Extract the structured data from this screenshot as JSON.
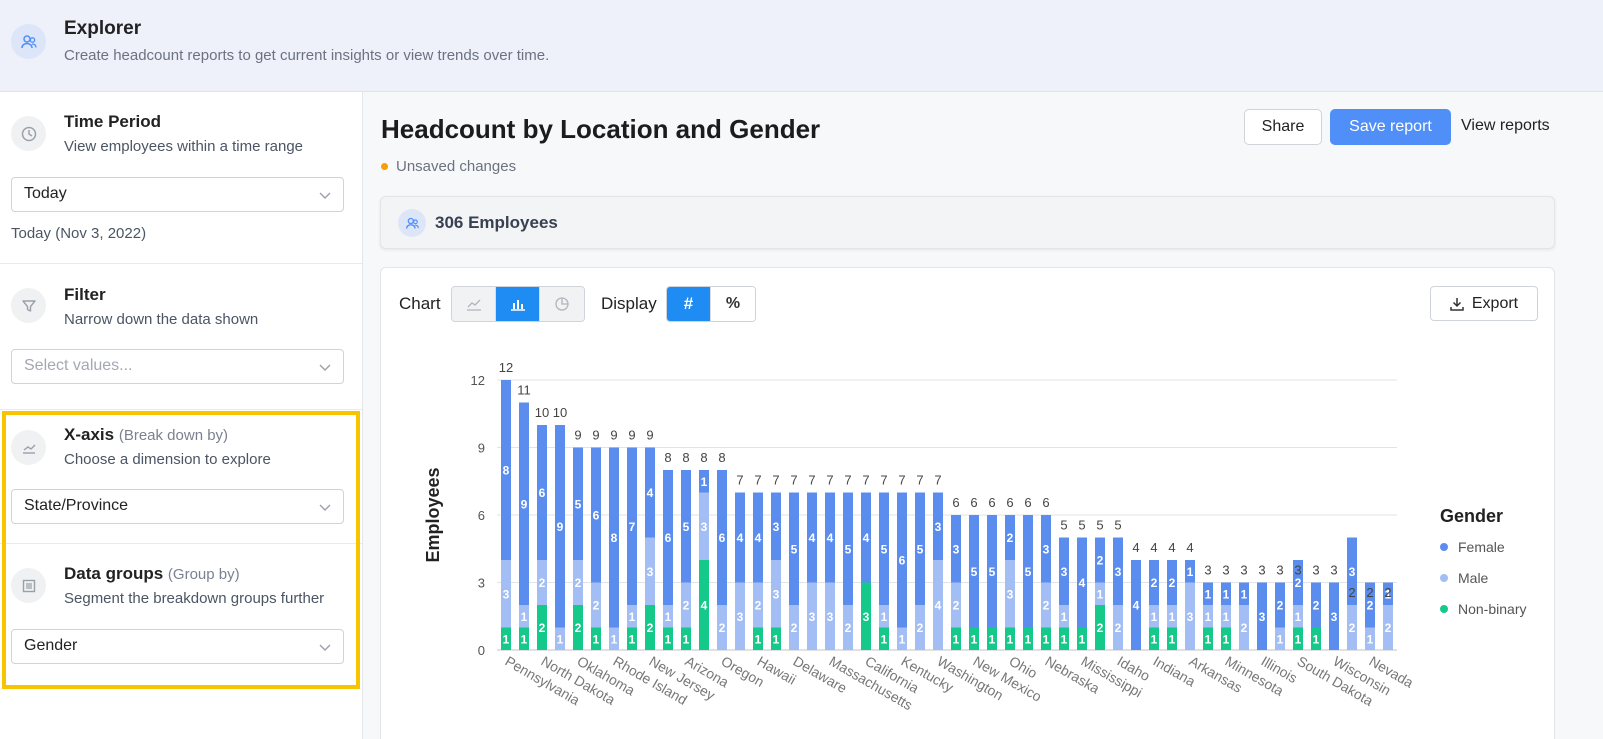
{
  "header": {
    "title": "Explorer",
    "subtitle": "Create headcount reports to get current insights or view trends over time."
  },
  "sidebar": {
    "time_period": {
      "title": "Time Period",
      "subtitle": "View employees within a time range",
      "selected": "Today",
      "note": "Today (Nov 3, 2022)"
    },
    "filter": {
      "title": "Filter",
      "subtitle": "Narrow down the data shown",
      "placeholder": "Select values..."
    },
    "x_axis": {
      "title": "X-axis",
      "hint": "(Break down by)",
      "subtitle": "Choose a dimension to explore",
      "selected": "State/Province"
    },
    "data_groups": {
      "title": "Data groups",
      "hint": "(Group by)",
      "subtitle": "Segment the breakdown groups further",
      "selected": "Gender"
    },
    "highlight_color": "#f8c400"
  },
  "main": {
    "title": "Headcount by Location and Gender",
    "unsaved": "Unsaved changes",
    "share_label": "Share",
    "save_label": "Save report",
    "view_reports_label": "View reports",
    "employees_count": "306 Employees",
    "chart_label": "Chart",
    "display_label": "Display",
    "export_label": "Export",
    "chart_type_options": [
      "line-chart-icon",
      "bar-chart-icon",
      "pie-chart-icon"
    ],
    "chart_type_selected": "bar-chart-icon",
    "display_options": [
      "#",
      "%"
    ],
    "display_selected": "#"
  },
  "chart_data": {
    "type": "bar",
    "stacked": true,
    "ylabel": "Employees",
    "ylim": [
      0,
      12
    ],
    "yticks": [
      0,
      3,
      6,
      9,
      12
    ],
    "grid": true,
    "legend_title": "Gender",
    "legend_placement": "right",
    "categories": [
      "Pennsylvania",
      "",
      "North Dakota",
      "",
      "Oklahoma",
      "",
      "Rhode Island",
      "",
      "New Jersey",
      "",
      "Arizona",
      "",
      "Oregon",
      "",
      "Hawaii",
      "",
      "Delaware",
      "",
      "Massachusetts",
      "",
      "California",
      "",
      "Kentucky",
      "",
      "Washington",
      "",
      "New Mexico",
      "",
      "Ohio",
      "",
      "Nebraska",
      "",
      "Mississippi",
      "",
      "Idaho",
      "",
      "Indiana",
      "",
      "Arkansas",
      "",
      "Minnesota",
      "",
      "Illinois",
      "",
      "South Dakota",
      "",
      "Wisconsin",
      "",
      "Nevada"
    ],
    "totals": [
      12,
      11,
      10,
      10,
      9,
      9,
      9,
      9,
      9,
      8,
      8,
      8,
      8,
      7,
      7,
      7,
      7,
      7,
      7,
      7,
      7,
      7,
      7,
      7,
      7,
      6,
      6,
      6,
      6,
      6,
      6,
      5,
      5,
      5,
      5,
      4,
      4,
      4,
      4,
      3,
      3,
      3,
      3,
      3,
      3,
      3,
      3,
      2,
      2,
      2
    ],
    "series": [
      {
        "name": "Female",
        "color": "#5b8def",
        "values": [
          8,
          9,
          6,
          9,
          5,
          6,
          8,
          7,
          4,
          6,
          5,
          1,
          6,
          4,
          4,
          3,
          5,
          4,
          4,
          5,
          4,
          5,
          6,
          5,
          3,
          3,
          5,
          5,
          2,
          5,
          3,
          3,
          4,
          2,
          3,
          4,
          2,
          2,
          1,
          1,
          1,
          1,
          3,
          2,
          2,
          2,
          3,
          3,
          2,
          1
        ]
      },
      {
        "name": "Male",
        "color": "#a3bdf5",
        "values": [
          3,
          1,
          2,
          1,
          2,
          2,
          1,
          1,
          3,
          1,
          2,
          3,
          2,
          3,
          2,
          3,
          2,
          3,
          3,
          2,
          0,
          1,
          1,
          2,
          4,
          2,
          0,
          0,
          3,
          0,
          2,
          1,
          0,
          1,
          2,
          0,
          1,
          1,
          3,
          1,
          1,
          2,
          0,
          1,
          1,
          0,
          0,
          2,
          1,
          2
        ]
      },
      {
        "name": "Non-binary",
        "color": "#14c98a",
        "values": [
          1,
          1,
          2,
          0,
          2,
          1,
          0,
          1,
          2,
          1,
          1,
          4,
          0,
          0,
          1,
          1,
          0,
          0,
          0,
          0,
          3,
          1,
          0,
          0,
          0,
          1,
          1,
          1,
          1,
          1,
          1,
          1,
          1,
          2,
          0,
          0,
          1,
          1,
          0,
          1,
          1,
          0,
          0,
          0,
          1,
          1,
          0,
          0,
          0,
          0
        ]
      }
    ]
  }
}
